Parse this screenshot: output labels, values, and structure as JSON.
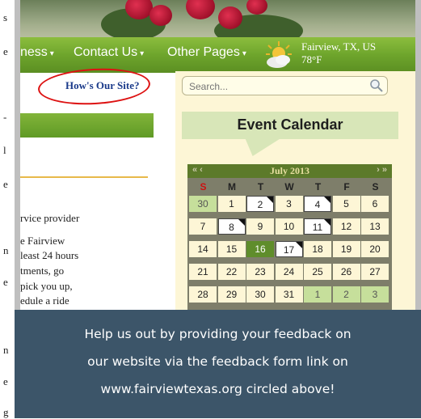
{
  "left_fragments": [
    "s",
    "e",
    "-",
    "l",
    "e",
    "n",
    "e",
    "n",
    "e",
    "g"
  ],
  "nav": {
    "items": [
      "ness",
      "Contact Us",
      "Other Pages"
    ],
    "caret": "▾",
    "weather_city": "Fairview, TX, US",
    "weather_temp": "78°F"
  },
  "feedback_link": "How's Our Site?",
  "search": {
    "placeholder": "Search..."
  },
  "main_text": [
    "rvice provider",
    "e Fairview",
    "least 24 hours",
    "tments, go",
    "pick you up,",
    "edule a ride"
  ],
  "event_calendar": {
    "title": "Event Calendar",
    "month": "July 2013",
    "nav_prev": "«  ‹",
    "nav_next": "›  »",
    "days_of_week": [
      "S",
      "M",
      "T",
      "W",
      "T",
      "F",
      "S"
    ],
    "weeks": [
      [
        {
          "d": "30",
          "s": "green"
        },
        {
          "d": "1"
        },
        {
          "d": "2",
          "s": "event"
        },
        {
          "d": "3"
        },
        {
          "d": "4",
          "s": "event"
        },
        {
          "d": "5"
        },
        {
          "d": "6"
        }
      ],
      [
        {
          "d": "7"
        },
        {
          "d": "8",
          "s": "event"
        },
        {
          "d": "9"
        },
        {
          "d": "10"
        },
        {
          "d": "11",
          "s": "event"
        },
        {
          "d": "12"
        },
        {
          "d": "13"
        }
      ],
      [
        {
          "d": "14"
        },
        {
          "d": "15"
        },
        {
          "d": "16",
          "s": "today"
        },
        {
          "d": "17",
          "s": "event"
        },
        {
          "d": "18"
        },
        {
          "d": "19"
        },
        {
          "d": "20"
        }
      ],
      [
        {
          "d": "21"
        },
        {
          "d": "22"
        },
        {
          "d": "23"
        },
        {
          "d": "24"
        },
        {
          "d": "25"
        },
        {
          "d": "26"
        },
        {
          "d": "27"
        }
      ],
      [
        {
          "d": "28"
        },
        {
          "d": "29"
        },
        {
          "d": "30"
        },
        {
          "d": "31"
        },
        {
          "d": "1",
          "s": "green"
        },
        {
          "d": "2",
          "s": "green"
        },
        {
          "d": "3",
          "s": "green"
        }
      ]
    ]
  },
  "caption_lines": [
    "Help us out by providing your feedback on",
    "our website via the feedback form link on",
    "www.fairviewtexas.org circled above!"
  ],
  "colors": {
    "nav_green": "#6ea52c",
    "caption_bg": "#3c5569",
    "calendar_header": "#5c7a2a",
    "sunday": "#cc1111"
  }
}
